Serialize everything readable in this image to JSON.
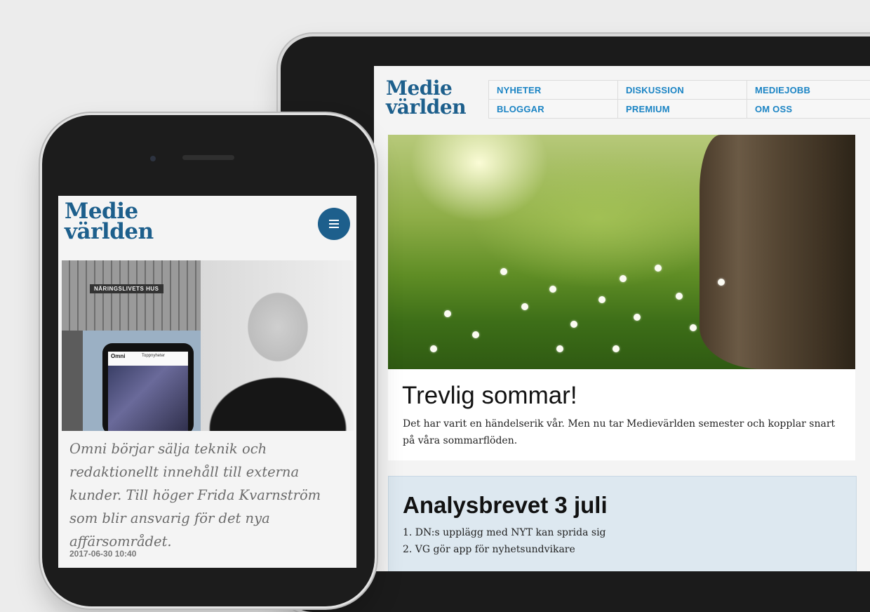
{
  "brand": {
    "logo_line1": "Medie",
    "logo_line2": "världen"
  },
  "tablet": {
    "nav": [
      {
        "label": "NYHETER"
      },
      {
        "label": "DISKUSSION"
      },
      {
        "label": "MEDIEJOBB"
      },
      {
        "label": "BLOGGAR"
      },
      {
        "label": "PREMIUM"
      },
      {
        "label": "OM OSS"
      }
    ],
    "hero_article": {
      "title": "Trevlig sommar!",
      "text": "Det har varit en händelserik vår. Men nu tar Medievärlden semester och kopplar snart på våra sommarflöden."
    },
    "analys": {
      "title": "Analysbrevet 3 juli",
      "items": [
        "1. DN:s upplägg med NYT kan sprida sig",
        "2. VG gör app för nyhetsundvikare"
      ]
    }
  },
  "phone": {
    "image_sign": "NÄRINGSLIVETS HUS",
    "image_device_app": "Omni",
    "image_device_tab": "Toppnyheter",
    "caption": "Omni börjar sälja teknik och redaktionellt innehåll till externa kunder. Till höger Frida Kvarnström som blir ansvarig för det nya affärsområdet.",
    "date": "2017-06-30 10:40"
  }
}
